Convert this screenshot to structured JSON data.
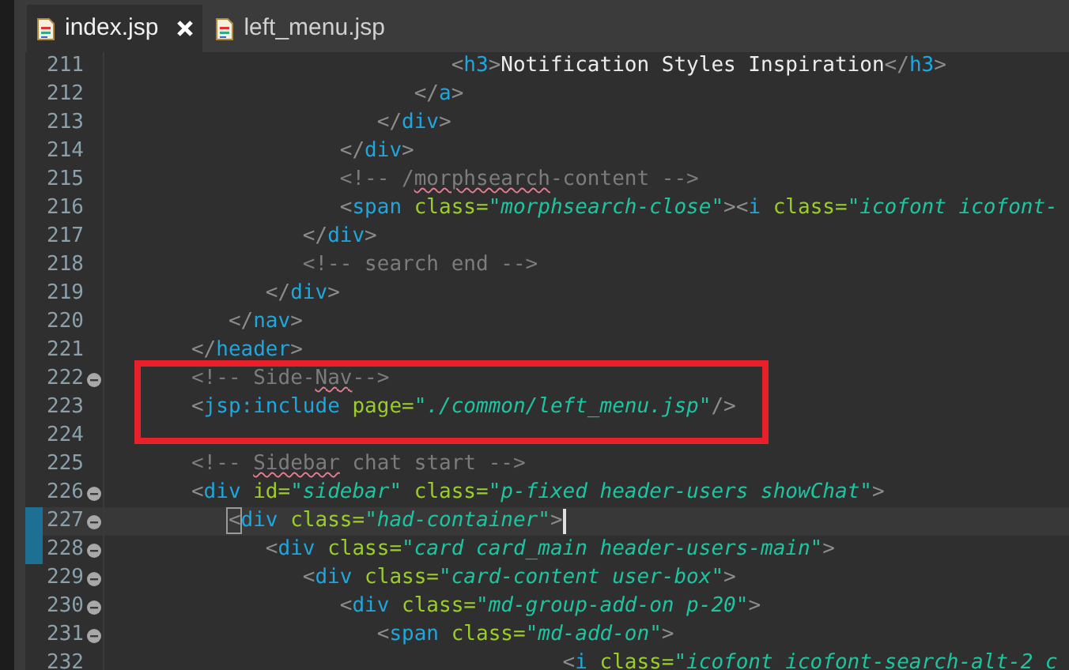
{
  "tabs": [
    {
      "label": "index.jsp",
      "selected": true
    },
    {
      "label": "left_menu.jsp",
      "selected": false
    }
  ],
  "editor": {
    "lines": [
      {
        "number": "211",
        "fold": false,
        "changed": false,
        "current": false,
        "boxed": false,
        "tokens": [
          {
            "kind": "punct",
            "text": "                           <"
          },
          {
            "kind": "tag",
            "text": "h3"
          },
          {
            "kind": "punct",
            "text": ">"
          },
          {
            "kind": "text",
            "text": "Notification Styles Inspiration"
          },
          {
            "kind": "punct",
            "text": "</"
          },
          {
            "kind": "tag",
            "text": "h3"
          },
          {
            "kind": "punct",
            "text": ">"
          }
        ]
      },
      {
        "number": "212",
        "fold": false,
        "changed": false,
        "current": false,
        "boxed": false,
        "tokens": [
          {
            "kind": "punct",
            "text": "                        </"
          },
          {
            "kind": "tag",
            "text": "a"
          },
          {
            "kind": "punct",
            "text": ">"
          }
        ]
      },
      {
        "number": "213",
        "fold": false,
        "changed": false,
        "current": false,
        "boxed": false,
        "tokens": [
          {
            "kind": "punct",
            "text": "                     </"
          },
          {
            "kind": "tag",
            "text": "div"
          },
          {
            "kind": "punct",
            "text": ">"
          }
        ]
      },
      {
        "number": "214",
        "fold": false,
        "changed": false,
        "current": false,
        "boxed": false,
        "tokens": [
          {
            "kind": "punct",
            "text": "                  </"
          },
          {
            "kind": "tag",
            "text": "div"
          },
          {
            "kind": "punct",
            "text": ">"
          }
        ]
      },
      {
        "number": "215",
        "fold": false,
        "changed": false,
        "current": false,
        "boxed": false,
        "tokens": [
          {
            "kind": "comment",
            "text": "                  <!-- /"
          },
          {
            "kind": "comment",
            "text": "morphsearch",
            "misspelled": true
          },
          {
            "kind": "comment",
            "text": "-content -->"
          }
        ]
      },
      {
        "number": "216",
        "fold": false,
        "changed": false,
        "current": false,
        "boxed": false,
        "tokens": [
          {
            "kind": "punct",
            "text": "                  <"
          },
          {
            "kind": "tag",
            "text": "span"
          },
          {
            "kind": "attr",
            "text": " class="
          },
          {
            "kind": "value",
            "text": "\"morphsearch-close\""
          },
          {
            "kind": "punct",
            "text": "><"
          },
          {
            "kind": "tag",
            "text": "i"
          },
          {
            "kind": "attr",
            "text": " class="
          },
          {
            "kind": "value",
            "text": "\"icofont icofont-"
          }
        ]
      },
      {
        "number": "217",
        "fold": false,
        "changed": false,
        "current": false,
        "boxed": false,
        "tokens": [
          {
            "kind": "punct",
            "text": "               </"
          },
          {
            "kind": "tag",
            "text": "div"
          },
          {
            "kind": "punct",
            "text": ">"
          }
        ]
      },
      {
        "number": "218",
        "fold": false,
        "changed": false,
        "current": false,
        "boxed": false,
        "tokens": [
          {
            "kind": "comment",
            "text": "               <!-- search end -->"
          }
        ]
      },
      {
        "number": "219",
        "fold": false,
        "changed": false,
        "current": false,
        "boxed": false,
        "tokens": [
          {
            "kind": "punct",
            "text": "            </"
          },
          {
            "kind": "tag",
            "text": "div"
          },
          {
            "kind": "punct",
            "text": ">"
          }
        ]
      },
      {
        "number": "220",
        "fold": false,
        "changed": false,
        "current": false,
        "boxed": false,
        "tokens": [
          {
            "kind": "punct",
            "text": "         </"
          },
          {
            "kind": "tag",
            "text": "nav"
          },
          {
            "kind": "punct",
            "text": ">"
          }
        ]
      },
      {
        "number": "221",
        "fold": false,
        "changed": false,
        "current": false,
        "boxed": false,
        "tokens": [
          {
            "kind": "punct",
            "text": "      </"
          },
          {
            "kind": "tag",
            "text": "header"
          },
          {
            "kind": "punct",
            "text": ">"
          }
        ]
      },
      {
        "number": "222",
        "fold": true,
        "changed": false,
        "current": false,
        "boxed": true,
        "tokens": [
          {
            "kind": "comment",
            "text": "      <!-- Side-"
          },
          {
            "kind": "comment",
            "text": "Nav",
            "misspelled": true
          },
          {
            "kind": "comment",
            "text": "-->"
          }
        ]
      },
      {
        "number": "223",
        "fold": false,
        "changed": false,
        "current": false,
        "boxed": true,
        "tokens": [
          {
            "kind": "punct",
            "text": "      <"
          },
          {
            "kind": "tag",
            "text": "jsp:include"
          },
          {
            "kind": "attr",
            "text": " page="
          },
          {
            "kind": "value",
            "text": "\"./common/left_menu.jsp\""
          },
          {
            "kind": "punct",
            "text": "/>"
          }
        ]
      },
      {
        "number": "224",
        "fold": false,
        "changed": false,
        "current": false,
        "boxed": true
      },
      {
        "number": "225",
        "fold": false,
        "changed": false,
        "current": false,
        "boxed": false,
        "tokens": [
          {
            "kind": "comment",
            "text": "      <!-- "
          },
          {
            "kind": "comment",
            "text": "Sidebar",
            "misspelled": true
          },
          {
            "kind": "comment",
            "text": " chat start -->"
          }
        ]
      },
      {
        "number": "226",
        "fold": true,
        "changed": false,
        "current": false,
        "boxed": false,
        "tokens": [
          {
            "kind": "punct",
            "text": "      <"
          },
          {
            "kind": "tag",
            "text": "div"
          },
          {
            "kind": "attr",
            "text": " id="
          },
          {
            "kind": "value",
            "text": "\"sidebar\""
          },
          {
            "kind": "attr",
            "text": " class="
          },
          {
            "kind": "value",
            "text": "\"p-fixed header-users showChat\""
          },
          {
            "kind": "punct",
            "text": ">"
          }
        ]
      },
      {
        "number": "227",
        "fold": true,
        "changed": true,
        "current": true,
        "boxed": false,
        "tokens": [
          {
            "kind": "punct",
            "text": "         <",
            "matched": true
          },
          {
            "kind": "tag",
            "text": "div"
          },
          {
            "kind": "attr",
            "text": " class="
          },
          {
            "kind": "value",
            "text": "\"had-container\""
          },
          {
            "kind": "punct",
            "text": ">"
          }
        ]
      },
      {
        "number": "228",
        "fold": true,
        "changed": true,
        "current": false,
        "boxed": false,
        "tokens": [
          {
            "kind": "punct",
            "text": "            <"
          },
          {
            "kind": "tag",
            "text": "div"
          },
          {
            "kind": "attr",
            "text": " class="
          },
          {
            "kind": "value",
            "text": "\"card card_main header-users-main\""
          },
          {
            "kind": "punct",
            "text": ">"
          }
        ]
      },
      {
        "number": "229",
        "fold": true,
        "changed": false,
        "current": false,
        "boxed": false,
        "tokens": [
          {
            "kind": "punct",
            "text": "               <"
          },
          {
            "kind": "tag",
            "text": "div"
          },
          {
            "kind": "attr",
            "text": " class="
          },
          {
            "kind": "value",
            "text": "\"card-content user-box\""
          },
          {
            "kind": "punct",
            "text": ">"
          }
        ]
      },
      {
        "number": "230",
        "fold": true,
        "changed": false,
        "current": false,
        "boxed": false,
        "tokens": [
          {
            "kind": "punct",
            "text": "                  <"
          },
          {
            "kind": "tag",
            "text": "div"
          },
          {
            "kind": "attr",
            "text": " class="
          },
          {
            "kind": "value",
            "text": "\"md-group-add-on p-20\""
          },
          {
            "kind": "punct",
            "text": ">"
          }
        ]
      },
      {
        "number": "231",
        "fold": true,
        "changed": false,
        "current": false,
        "boxed": false,
        "tokens": [
          {
            "kind": "punct",
            "text": "                     <"
          },
          {
            "kind": "tag",
            "text": "span"
          },
          {
            "kind": "attr",
            "text": " class="
          },
          {
            "kind": "value",
            "text": "\"md-add-on\""
          },
          {
            "kind": "punct",
            "text": ">"
          }
        ]
      },
      {
        "number": "232",
        "fold": false,
        "changed": false,
        "current": false,
        "boxed": false,
        "tokens": [
          {
            "kind": "punct",
            "text": "                                    <"
          },
          {
            "kind": "tag",
            "text": "i"
          },
          {
            "kind": "attr",
            "text": " class="
          },
          {
            "kind": "value",
            "text": "\"icofont icofont-search-alt-2 c"
          }
        ]
      }
    ]
  }
}
